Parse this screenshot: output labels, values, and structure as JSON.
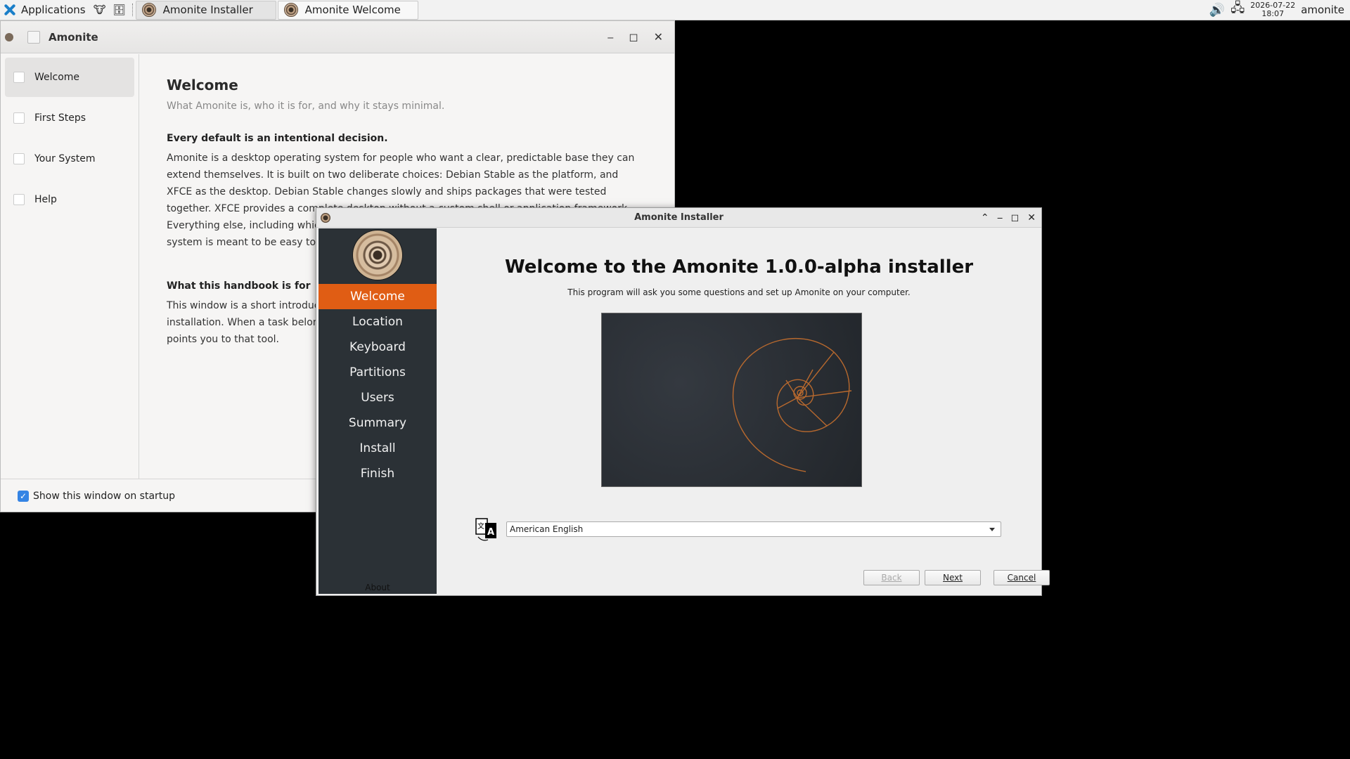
{
  "panel": {
    "applications_label": "Applications",
    "tasks": [
      {
        "label": "Amonite Installer"
      },
      {
        "label": "Amonite Welcome"
      }
    ],
    "clock_date": "2026-07-22",
    "clock_time": "18:07",
    "user": "amonite"
  },
  "welcome": {
    "title": "Amonite",
    "sidebar": [
      {
        "label": "Welcome"
      },
      {
        "label": "First Steps"
      },
      {
        "label": "Your System"
      },
      {
        "label": "Help"
      }
    ],
    "heading": "Welcome",
    "subtitle": "What Amonite is, who it is for, and why it stays minimal.",
    "section1_title": "Every default is an intentional decision.",
    "section1_text": "Amonite is a desktop operating system for people who want a clear, predictable base they can extend themselves. It is built on two deliberate choices: Debian Stable as the platform, and XFCE as the desktop. Debian Stable changes slowly and ships packages that were tested together. XFCE provides a complete desktop without a custom shell or application framework. Everything else, including which packages ship by default, follows from those two decisions. The system is meant to be easy to understand and change.",
    "section2_title": "What this handbook is for",
    "section2_text": "This window is a short introduction to Amonite. It helps you take the first useful steps after installation. When a task belongs to system settings, or the package manager, this handbook points you to that tool.",
    "show_on_startup": "Show this window on startup"
  },
  "installer": {
    "title": "Amonite Installer",
    "steps": [
      {
        "label": "Welcome"
      },
      {
        "label": "Location"
      },
      {
        "label": "Keyboard"
      },
      {
        "label": "Partitions"
      },
      {
        "label": "Users"
      },
      {
        "label": "Summary"
      },
      {
        "label": "Install"
      },
      {
        "label": "Finish"
      }
    ],
    "current_step": "Welcome",
    "about_label": "About",
    "heading": "Welcome to the Amonite 1.0.0-alpha installer",
    "subheading": "This program will ask you some questions and set up Amonite on your computer.",
    "language_value": "American English",
    "back_label": "Back",
    "next_label": "Next",
    "cancel_label": "Cancel",
    "accent_color": "#e05d14",
    "sidebar_color": "#2b3136"
  }
}
